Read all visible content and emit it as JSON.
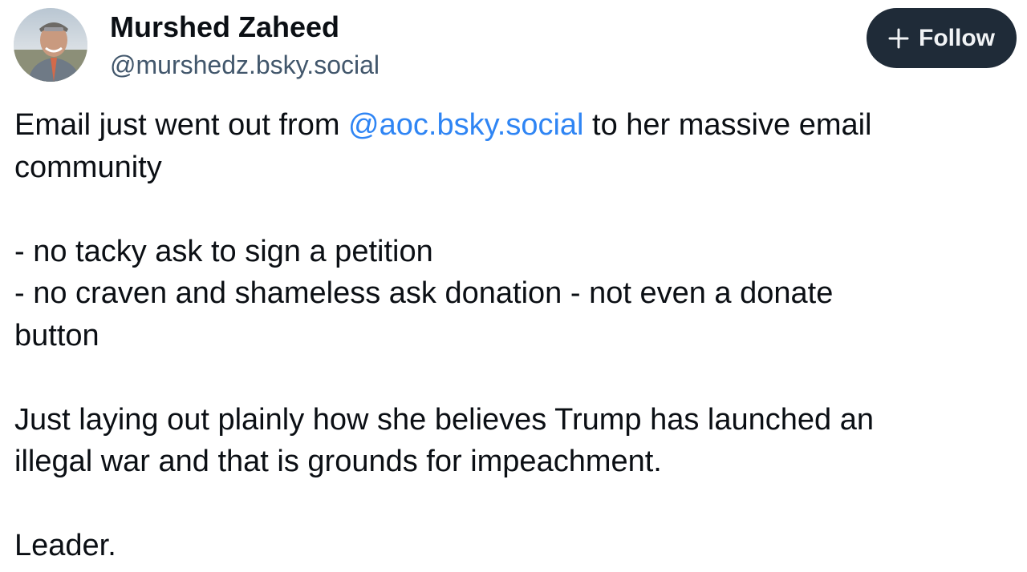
{
  "author": {
    "display_name": "Murshed Zaheed",
    "handle": "@murshedz.bsky.social"
  },
  "follow_button": {
    "label": "Follow",
    "icon": "plus-icon"
  },
  "post": {
    "line1_before": "Email just went out from ",
    "mention": "@aoc.bsky.social",
    "line1_after": " to her massive email",
    "line2": "community",
    "bullet1": "- no tacky ask to sign a petition",
    "bullet2_line1": "- no craven and shameless ask donation - not even a donate",
    "bullet2_line2": "button",
    "paragraph_line1": "Just laying out plainly how she believes Trump has launched an",
    "paragraph_line2": "illegal war and that is grounds for impeachment.",
    "closing": "Leader."
  },
  "colors": {
    "text": "#0b0f14",
    "handle": "#42576c",
    "mention": "#2f85f4",
    "follow_bg": "#1f2b38",
    "follow_text": "#f1f3f5"
  }
}
